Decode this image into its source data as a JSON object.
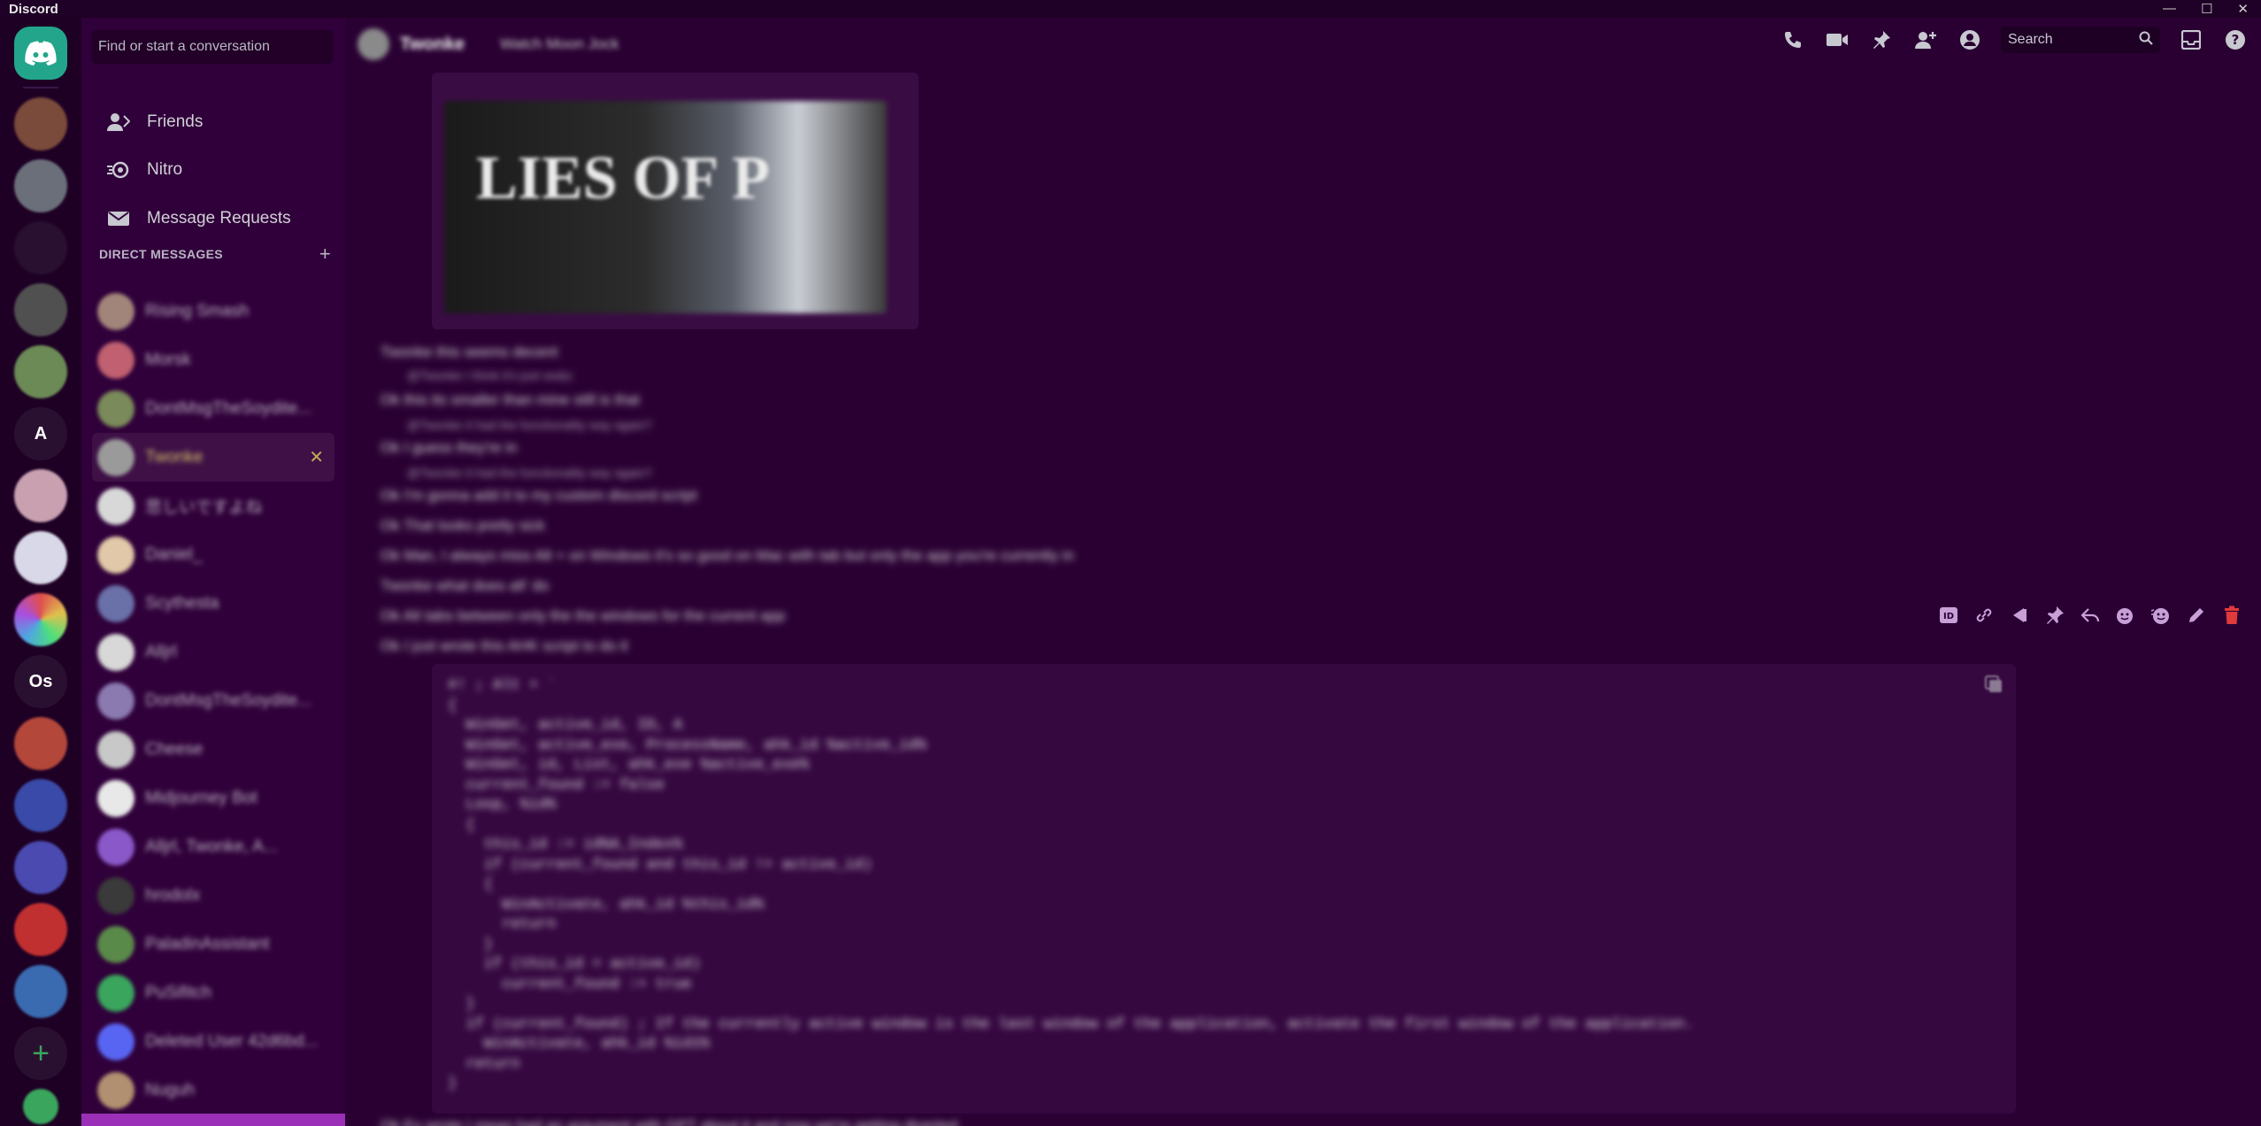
{
  "window": {
    "title": "Discord",
    "controls": [
      "—",
      "☐",
      "✕"
    ]
  },
  "server_rail": {
    "items": [
      {
        "label": "",
        "color": "#23a58c"
      },
      {
        "label": "",
        "color": "#7a4a3a"
      },
      {
        "label": "",
        "color": "#6a6f7a"
      },
      {
        "label": "",
        "color": "#4455dd"
      },
      {
        "label": "",
        "color": "#505050"
      },
      {
        "label": "",
        "color": "#6b8a55"
      },
      {
        "label": "A",
        "color": "#2a1030"
      },
      {
        "label": "",
        "color": "#c8a0b0"
      },
      {
        "label": "",
        "color": "#d8d8e8"
      },
      {
        "label": "",
        "color": "#e04e8a"
      },
      {
        "label": "Os",
        "color": "#2a1030"
      },
      {
        "label": "",
        "color": "#b3473a"
      },
      {
        "label": "",
        "color": "#3a4aa8"
      },
      {
        "label": "",
        "color": "#4a4ab0"
      },
      {
        "label": "",
        "color": "#c03030"
      },
      {
        "label": "",
        "color": "#3a6ab0"
      },
      {
        "label": "+",
        "color": "#2a1030"
      },
      {
        "label": "",
        "color": "#3aa55d"
      }
    ]
  },
  "sidebar": {
    "search_placeholder": "Find or start a conversation",
    "nav": [
      {
        "label": "Friends",
        "icon": "friends-icon"
      },
      {
        "label": "Nitro",
        "icon": "nitro-icon"
      },
      {
        "label": "Message Requests",
        "icon": "envelope-icon"
      }
    ],
    "dm_header": "DIRECT MESSAGES",
    "dm_add": "+",
    "dms": [
      {
        "name": "Rising Smash",
        "color": "#a2857a"
      },
      {
        "name": "Morsk",
        "color": "#c06070"
      },
      {
        "name": "DontMsgTheSoydite...",
        "color": "#7a8a5a"
      },
      {
        "name": "Twonke",
        "color": "#9a9a9a",
        "selected": true
      },
      {
        "name": "悲しいですよね",
        "color": "#d8d8d8"
      },
      {
        "name": "Daniel_",
        "color": "#e0c8a8"
      },
      {
        "name": "Scythesta",
        "color": "#6a70a8"
      },
      {
        "name": "Alljrl",
        "color": "#d8d8d8"
      },
      {
        "name": "DontMsgTheSoydite...",
        "color": "#8a7ab0"
      },
      {
        "name": "Cheese",
        "color": "#c8c8c8"
      },
      {
        "name": "Midjourney Bot",
        "color": "#e8e8e8"
      },
      {
        "name": "Alljrl, Twonke, A...",
        "color": "#8a58c8"
      },
      {
        "name": "hrodolx",
        "color": "#3a3a3a"
      },
      {
        "name": "PaladinAssistant",
        "color": "#5a8a4a"
      },
      {
        "name": "PuSifitch",
        "color": "#3aa55d"
      },
      {
        "name": "Deleted User 42d6bd...",
        "color": "#5865f2"
      },
      {
        "name": "Nuguh",
        "color": "#b09070"
      }
    ]
  },
  "chat": {
    "recipient": "Twonke",
    "status": "Watch Moon Jock",
    "search_placeholder": "Search",
    "image_title": "LIES OF P",
    "messages": [
      {
        "text": "Twonke this seems decent"
      },
      {
        "text": "@Twonke I think it's just ws&z",
        "reply": true
      },
      {
        "text": "Ok this its smaller than mine still is that"
      },
      {
        "text": "@Twonke it had the functionality way again?",
        "reply": true
      },
      {
        "text": "Ok I guess they're in"
      },
      {
        "text": "@Twonke it had the functionality way again?",
        "reply": true
      },
      {
        "text": "Ok I'm gonna add it to my custom discord script"
      },
      {
        "text": "Ok That looks pretty sick"
      },
      {
        "text": "Ok Man, I always miss Alt + on Windows it's so good on Mac with tab but only the app you're currently in"
      },
      {
        "text": "Twonke what does alt' do"
      },
      {
        "text": "Ok Alt tabs between only the the windows for the current app"
      },
      {
        "text": "Ok I just wrote this AHK script to do it"
      }
    ],
    "code": [
      "#! ; Alt + `",
      "{",
      "  WinGet, active_id, ID, A",
      "  WinGet, active_exe, ProcessName, ahk_id %active_id%",
      "  WinGet, id, List, ahk_exe %active_exe%",
      "  current_found := false",
      "  Loop, %id%",
      "  {",
      "    this_id := id%A_Index%",
      "    if (current_found and this_id != active_id)",
      "    {",
      "      WinActivate, ahk_id %this_id%",
      "      return",
      "    }",
      "    if (this_id = active_id)",
      "      current_found := true",
      "  }",
      "  if (current_found) ; If the currently active window is the last window of the application, activate the first window of the application.",
      "    WinActivate, ahk_id %id1%",
      "  return",
      "}"
    ],
    "last_message": "Ok Ey wrote I mean had an argument with GPT about it and now we're getting diverted"
  }
}
